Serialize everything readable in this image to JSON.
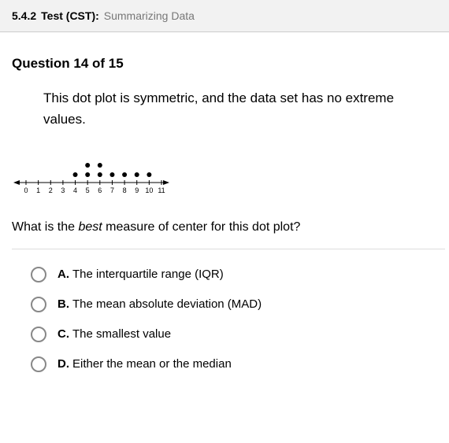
{
  "header": {
    "code": "5.4.2",
    "label": "Test (CST):",
    "title": "Summarizing Data"
  },
  "question": {
    "number": "Question 14 of 15",
    "text": "This dot plot is symmetric, and the data set has no extreme values.",
    "prompt_pre": "What is the ",
    "prompt_em": "best",
    "prompt_post": " measure of center for this dot plot?"
  },
  "options": [
    {
      "letter": "A.",
      "text": "The interquartile range (IQR)"
    },
    {
      "letter": "B.",
      "text": "The mean absolute deviation (MAD)"
    },
    {
      "letter": "C.",
      "text": "The smallest value"
    },
    {
      "letter": "D.",
      "text": "Either the mean or the median"
    }
  ],
  "chart_data": {
    "type": "dotplot",
    "x_ticks": [
      0,
      1,
      2,
      3,
      4,
      5,
      6,
      7,
      8,
      9,
      10,
      11
    ],
    "points": [
      {
        "x": 4,
        "count": 1
      },
      {
        "x": 5,
        "count": 2
      },
      {
        "x": 6,
        "count": 2
      },
      {
        "x": 7,
        "count": 1
      },
      {
        "x": 8,
        "count": 1
      },
      {
        "x": 9,
        "count": 1
      },
      {
        "x": 10,
        "count": 1
      }
    ]
  }
}
